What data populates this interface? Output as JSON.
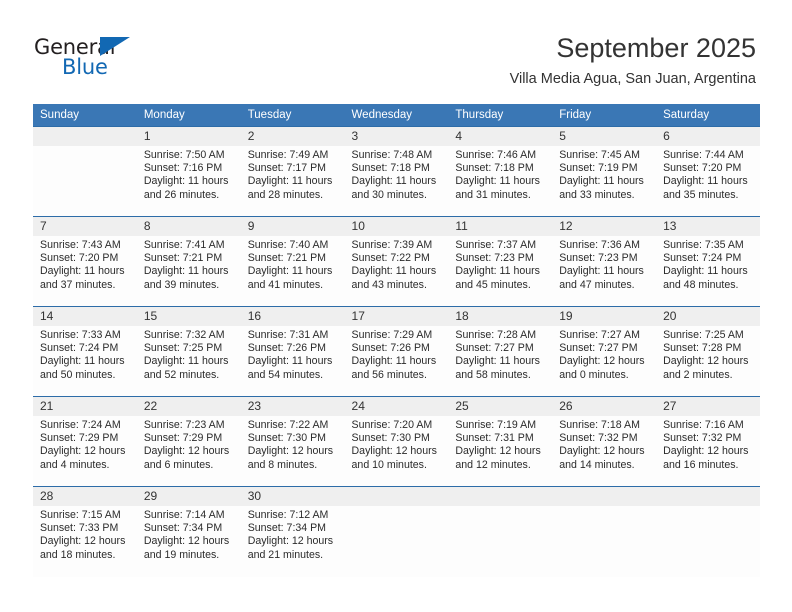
{
  "brand": {
    "name_top": "General",
    "name_bottom": "Blue",
    "accent_color": "#1268b3"
  },
  "header": {
    "title": "September 2025",
    "subtitle": "Villa Media Agua, San Juan, Argentina"
  },
  "calendar": {
    "header_bg": "#3a77b5",
    "daynum_bg": "#efefef",
    "weekdays": [
      "Sunday",
      "Monday",
      "Tuesday",
      "Wednesday",
      "Thursday",
      "Friday",
      "Saturday"
    ],
    "labels": {
      "sunrise": "Sunrise:",
      "sunset": "Sunset:",
      "daylight": "Daylight:"
    },
    "weeks": [
      [
        {
          "day": "",
          "blank": true
        },
        {
          "day": "1",
          "sunrise": "Sunrise: 7:50 AM",
          "sunset": "Sunset: 7:16 PM",
          "daylight1": "Daylight: 11 hours",
          "daylight2": "and 26 minutes."
        },
        {
          "day": "2",
          "sunrise": "Sunrise: 7:49 AM",
          "sunset": "Sunset: 7:17 PM",
          "daylight1": "Daylight: 11 hours",
          "daylight2": "and 28 minutes."
        },
        {
          "day": "3",
          "sunrise": "Sunrise: 7:48 AM",
          "sunset": "Sunset: 7:18 PM",
          "daylight1": "Daylight: 11 hours",
          "daylight2": "and 30 minutes."
        },
        {
          "day": "4",
          "sunrise": "Sunrise: 7:46 AM",
          "sunset": "Sunset: 7:18 PM",
          "daylight1": "Daylight: 11 hours",
          "daylight2": "and 31 minutes."
        },
        {
          "day": "5",
          "sunrise": "Sunrise: 7:45 AM",
          "sunset": "Sunset: 7:19 PM",
          "daylight1": "Daylight: 11 hours",
          "daylight2": "and 33 minutes."
        },
        {
          "day": "6",
          "sunrise": "Sunrise: 7:44 AM",
          "sunset": "Sunset: 7:20 PM",
          "daylight1": "Daylight: 11 hours",
          "daylight2": "and 35 minutes."
        }
      ],
      [
        {
          "day": "7",
          "sunrise": "Sunrise: 7:43 AM",
          "sunset": "Sunset: 7:20 PM",
          "daylight1": "Daylight: 11 hours",
          "daylight2": "and 37 minutes."
        },
        {
          "day": "8",
          "sunrise": "Sunrise: 7:41 AM",
          "sunset": "Sunset: 7:21 PM",
          "daylight1": "Daylight: 11 hours",
          "daylight2": "and 39 minutes."
        },
        {
          "day": "9",
          "sunrise": "Sunrise: 7:40 AM",
          "sunset": "Sunset: 7:21 PM",
          "daylight1": "Daylight: 11 hours",
          "daylight2": "and 41 minutes."
        },
        {
          "day": "10",
          "sunrise": "Sunrise: 7:39 AM",
          "sunset": "Sunset: 7:22 PM",
          "daylight1": "Daylight: 11 hours",
          "daylight2": "and 43 minutes."
        },
        {
          "day": "11",
          "sunrise": "Sunrise: 7:37 AM",
          "sunset": "Sunset: 7:23 PM",
          "daylight1": "Daylight: 11 hours",
          "daylight2": "and 45 minutes."
        },
        {
          "day": "12",
          "sunrise": "Sunrise: 7:36 AM",
          "sunset": "Sunset: 7:23 PM",
          "daylight1": "Daylight: 11 hours",
          "daylight2": "and 47 minutes."
        },
        {
          "day": "13",
          "sunrise": "Sunrise: 7:35 AM",
          "sunset": "Sunset: 7:24 PM",
          "daylight1": "Daylight: 11 hours",
          "daylight2": "and 48 minutes."
        }
      ],
      [
        {
          "day": "14",
          "sunrise": "Sunrise: 7:33 AM",
          "sunset": "Sunset: 7:24 PM",
          "daylight1": "Daylight: 11 hours",
          "daylight2": "and 50 minutes."
        },
        {
          "day": "15",
          "sunrise": "Sunrise: 7:32 AM",
          "sunset": "Sunset: 7:25 PM",
          "daylight1": "Daylight: 11 hours",
          "daylight2": "and 52 minutes."
        },
        {
          "day": "16",
          "sunrise": "Sunrise: 7:31 AM",
          "sunset": "Sunset: 7:26 PM",
          "daylight1": "Daylight: 11 hours",
          "daylight2": "and 54 minutes."
        },
        {
          "day": "17",
          "sunrise": "Sunrise: 7:29 AM",
          "sunset": "Sunset: 7:26 PM",
          "daylight1": "Daylight: 11 hours",
          "daylight2": "and 56 minutes."
        },
        {
          "day": "18",
          "sunrise": "Sunrise: 7:28 AM",
          "sunset": "Sunset: 7:27 PM",
          "daylight1": "Daylight: 11 hours",
          "daylight2": "and 58 minutes."
        },
        {
          "day": "19",
          "sunrise": "Sunrise: 7:27 AM",
          "sunset": "Sunset: 7:27 PM",
          "daylight1": "Daylight: 12 hours",
          "daylight2": "and 0 minutes."
        },
        {
          "day": "20",
          "sunrise": "Sunrise: 7:25 AM",
          "sunset": "Sunset: 7:28 PM",
          "daylight1": "Daylight: 12 hours",
          "daylight2": "and 2 minutes."
        }
      ],
      [
        {
          "day": "21",
          "sunrise": "Sunrise: 7:24 AM",
          "sunset": "Sunset: 7:29 PM",
          "daylight1": "Daylight: 12 hours",
          "daylight2": "and 4 minutes."
        },
        {
          "day": "22",
          "sunrise": "Sunrise: 7:23 AM",
          "sunset": "Sunset: 7:29 PM",
          "daylight1": "Daylight: 12 hours",
          "daylight2": "and 6 minutes."
        },
        {
          "day": "23",
          "sunrise": "Sunrise: 7:22 AM",
          "sunset": "Sunset: 7:30 PM",
          "daylight1": "Daylight: 12 hours",
          "daylight2": "and 8 minutes."
        },
        {
          "day": "24",
          "sunrise": "Sunrise: 7:20 AM",
          "sunset": "Sunset: 7:30 PM",
          "daylight1": "Daylight: 12 hours",
          "daylight2": "and 10 minutes."
        },
        {
          "day": "25",
          "sunrise": "Sunrise: 7:19 AM",
          "sunset": "Sunset: 7:31 PM",
          "daylight1": "Daylight: 12 hours",
          "daylight2": "and 12 minutes."
        },
        {
          "day": "26",
          "sunrise": "Sunrise: 7:18 AM",
          "sunset": "Sunset: 7:32 PM",
          "daylight1": "Daylight: 12 hours",
          "daylight2": "and 14 minutes."
        },
        {
          "day": "27",
          "sunrise": "Sunrise: 7:16 AM",
          "sunset": "Sunset: 7:32 PM",
          "daylight1": "Daylight: 12 hours",
          "daylight2": "and 16 minutes."
        }
      ],
      [
        {
          "day": "28",
          "sunrise": "Sunrise: 7:15 AM",
          "sunset": "Sunset: 7:33 PM",
          "daylight1": "Daylight: 12 hours",
          "daylight2": "and 18 minutes."
        },
        {
          "day": "29",
          "sunrise": "Sunrise: 7:14 AM",
          "sunset": "Sunset: 7:34 PM",
          "daylight1": "Daylight: 12 hours",
          "daylight2": "and 19 minutes."
        },
        {
          "day": "30",
          "sunrise": "Sunrise: 7:12 AM",
          "sunset": "Sunset: 7:34 PM",
          "daylight1": "Daylight: 12 hours",
          "daylight2": "and 21 minutes."
        },
        {
          "day": "",
          "blank": true
        },
        {
          "day": "",
          "blank": true
        },
        {
          "day": "",
          "blank": true
        },
        {
          "day": "",
          "blank": true
        }
      ]
    ]
  }
}
